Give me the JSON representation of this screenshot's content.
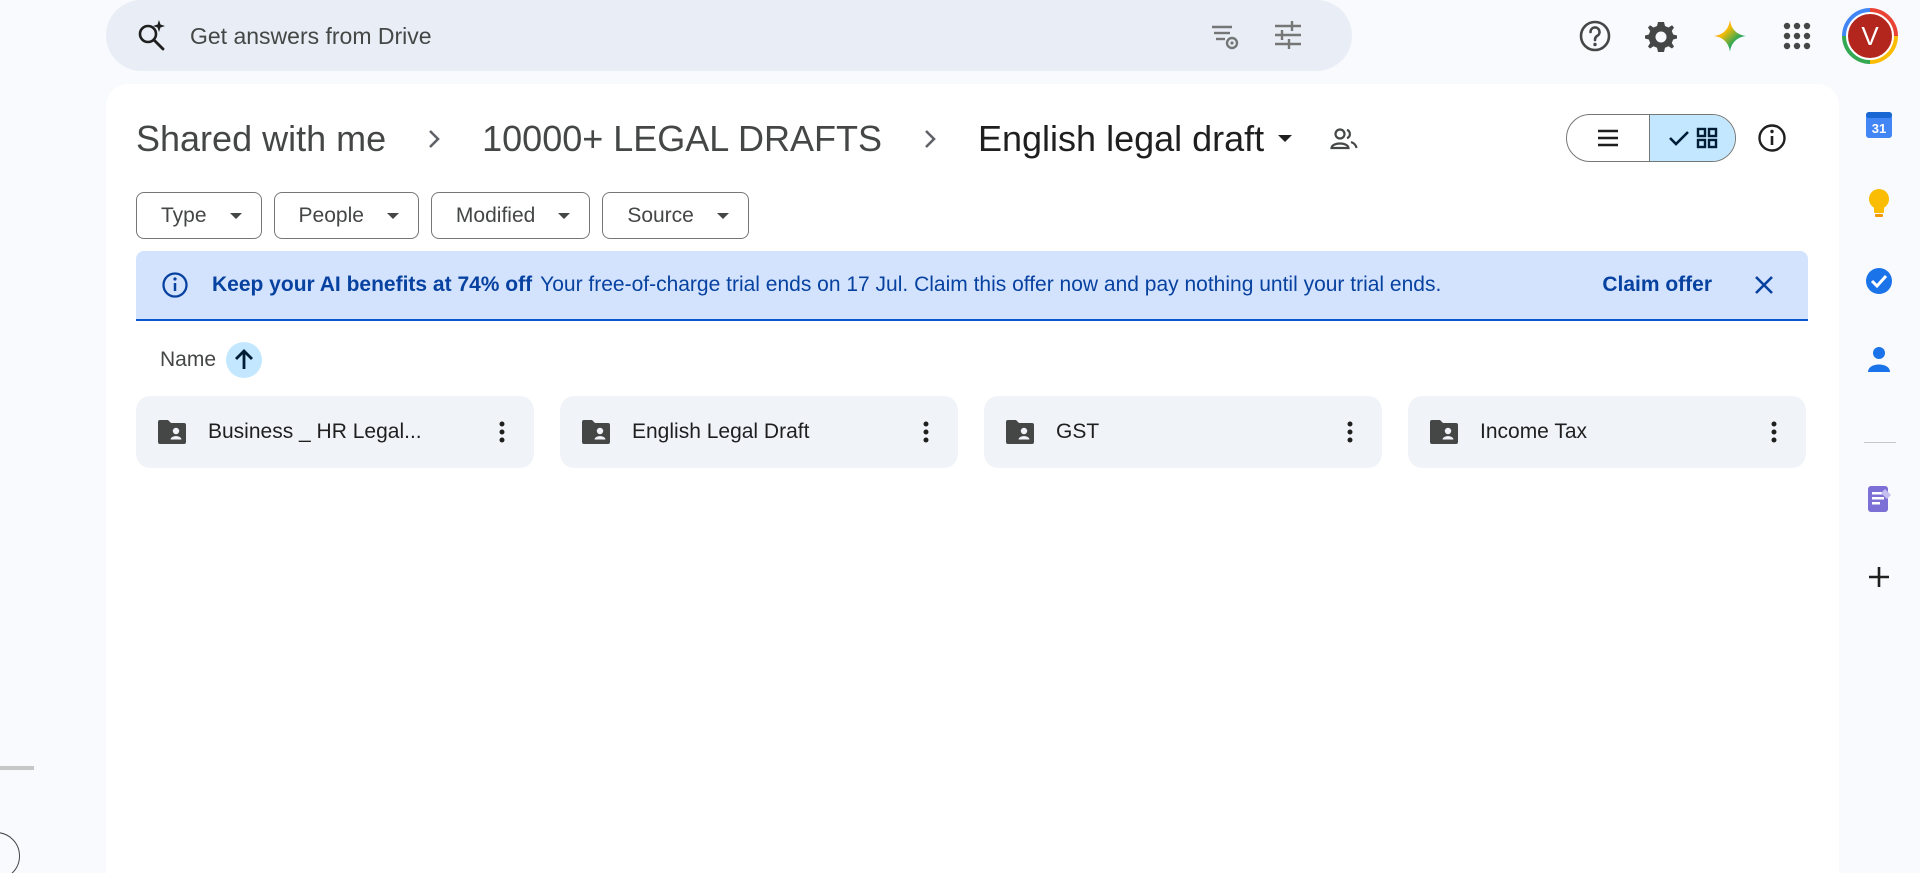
{
  "search": {
    "placeholder": "Get answers from Drive"
  },
  "header_icons": {
    "help": "help-icon",
    "settings": "gear-icon",
    "gemini": "gemini-sparkle-icon",
    "apps": "apps-grid-icon"
  },
  "avatar": {
    "initial": "V",
    "color": "#b3261e"
  },
  "breadcrumb": {
    "items": [
      "Shared with me",
      "10000+ LEGAL DRAFTS"
    ],
    "current": "English legal draft"
  },
  "filters": {
    "chips": [
      "Type",
      "People",
      "Modified",
      "Source"
    ]
  },
  "banner": {
    "headline": "Keep your AI benefits at 74% off",
    "message": "Your free-of-charge trial ends on 17 Jul. Claim this offer now and pay nothing until your trial ends.",
    "cta": "Claim offer"
  },
  "sort": {
    "label": "Name",
    "direction": "ascending"
  },
  "folders": [
    {
      "name": "Business _ HR Legal..."
    },
    {
      "name": "English Legal Draft"
    },
    {
      "name": "GST"
    },
    {
      "name": "Income Tax"
    }
  ],
  "side_panel": {
    "calendar_day": "31",
    "apps": [
      "calendar-icon",
      "keep-icon",
      "tasks-icon",
      "contacts-icon",
      "notebook-icon",
      "add-icon"
    ]
  },
  "colors": {
    "accent": "#0b57d0",
    "banner_bg": "#d3e3fd",
    "selected_bg": "#c2e7ff",
    "folder_bg": "#f0f4f9"
  }
}
